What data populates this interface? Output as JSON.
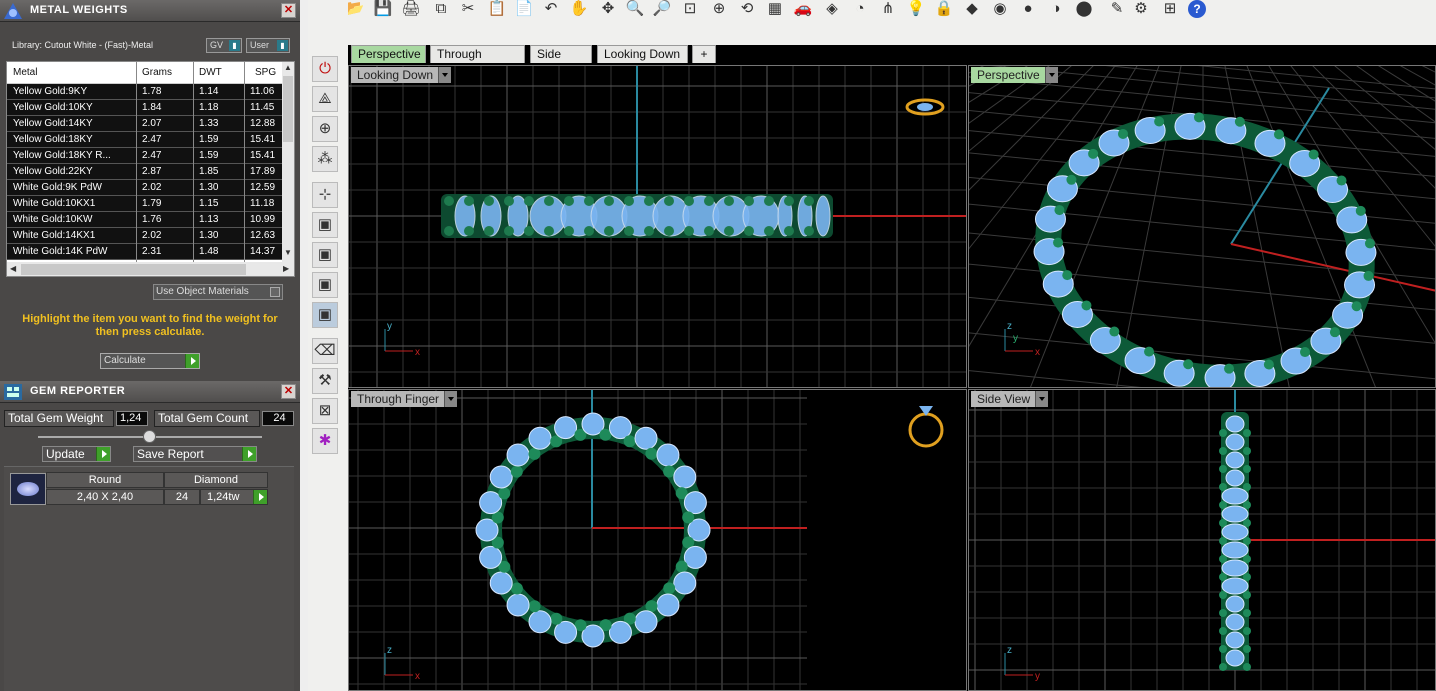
{
  "metal_panel": {
    "title": "METAL WEIGHTS",
    "library": "Library: Cutout White - (Fast)-Metal",
    "gv_label": "GV",
    "user_label": "User",
    "columns": [
      "Metal",
      "Grams",
      "DWT",
      "SPG"
    ],
    "rows": [
      [
        "Yellow Gold:9KY",
        "1.78",
        "1.14",
        "11.06"
      ],
      [
        "Yellow Gold:10KY",
        "1.84",
        "1.18",
        "11.45"
      ],
      [
        "Yellow Gold:14KY",
        "2.07",
        "1.33",
        "12.88"
      ],
      [
        "Yellow Gold:18KY",
        "2.47",
        "1.59",
        "15.41"
      ],
      [
        "Yellow Gold:18KY R...",
        "2.47",
        "1.59",
        "15.41"
      ],
      [
        "Yellow Gold:22KY",
        "2.87",
        "1.85",
        "17.89"
      ],
      [
        "White Gold:9K PdW",
        "2.02",
        "1.30",
        "12.59"
      ],
      [
        "White Gold:10KX1",
        "1.79",
        "1.15",
        "11.18"
      ],
      [
        "White Gold:10KW",
        "1.76",
        "1.13",
        "10.99"
      ],
      [
        "White Gold:14KX1",
        "2.02",
        "1.30",
        "12.63"
      ],
      [
        "White Gold:14K PdW",
        "2.31",
        "1.48",
        "14.37"
      ]
    ],
    "use_object_materials": "Use Object Materials",
    "hint": "Highlight the item you want to find the weight for then press calculate.",
    "calculate": "Calculate"
  },
  "gem_panel": {
    "title": "GEM REPORTER",
    "total_weight_label": "Total Gem Weight",
    "total_weight_value": "1,24",
    "total_count_label": "Total Gem Count",
    "total_count_value": "24",
    "update": "Update",
    "save_report": "Save Report",
    "gem": {
      "shape": "Round",
      "material": "Diamond",
      "size": "2,40 X 2,40",
      "count": "24",
      "weight": "1,24tw"
    }
  },
  "tabs": [
    "Perspective",
    "Through Finger",
    "Side View",
    "Looking Down",
    "+"
  ],
  "viewports": {
    "top_left": "Looking Down",
    "top_right": "Perspective",
    "bottom_left": "Through Finger",
    "bottom_right": "Side View"
  },
  "axes": {
    "top_left": [
      "y",
      "x"
    ],
    "top_right": [
      "z",
      "y",
      "x"
    ],
    "bottom_left": [
      "z",
      "x"
    ],
    "bottom_right": [
      "z",
      "y"
    ]
  },
  "colors": {
    "accent_green": "#a8d8a0",
    "hint_yellow": "#f0c020",
    "metal": "#1e7a4e",
    "gem": "#7ab4f0"
  }
}
